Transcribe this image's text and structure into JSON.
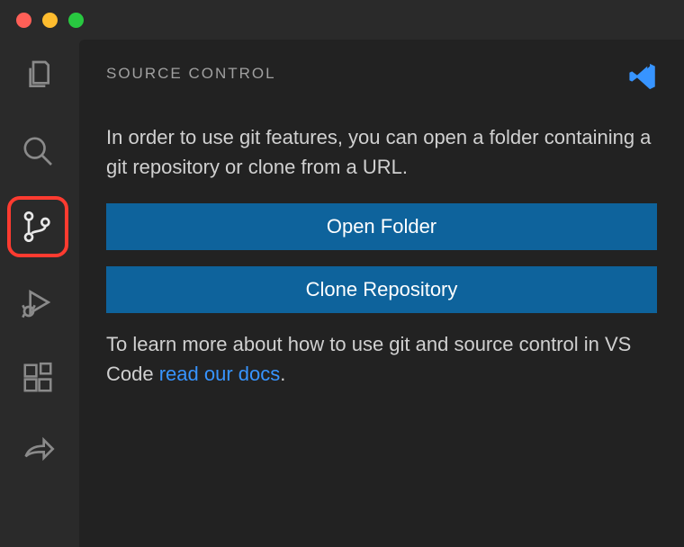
{
  "panel": {
    "title": "SOURCE CONTROL",
    "description": "In order to use git features, you can open a folder containing a git repository or clone from a URL.",
    "open_folder_label": "Open Folder",
    "clone_repo_label": "Clone Repository",
    "footer_prefix": "To learn more about how to use git and source control in VS Code ",
    "footer_link": "read our docs",
    "footer_suffix": "."
  },
  "activity_bar": {
    "items": [
      {
        "name": "explorer",
        "active": false
      },
      {
        "name": "search",
        "active": false
      },
      {
        "name": "source-control",
        "active": true,
        "highlighted": true
      },
      {
        "name": "run-debug",
        "active": false
      },
      {
        "name": "extensions",
        "active": false
      },
      {
        "name": "live-share",
        "active": false
      }
    ]
  },
  "colors": {
    "button_bg": "#0e639c",
    "link": "#3794ff",
    "highlight": "#ff3b30"
  }
}
